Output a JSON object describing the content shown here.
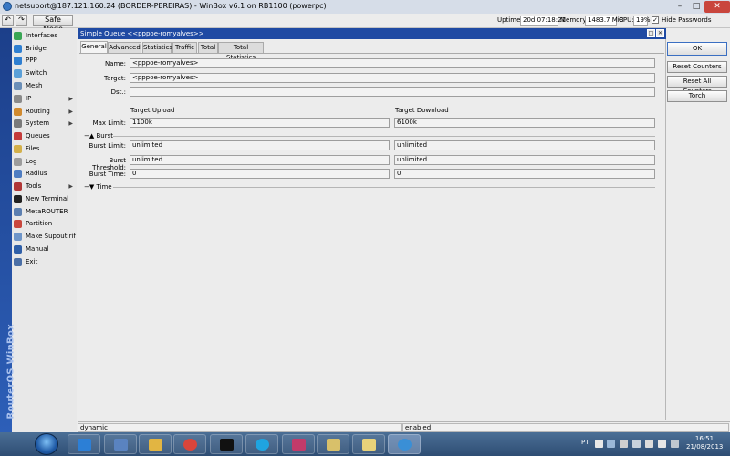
{
  "window": {
    "title": "netsuport@187.121.160.24 (BORDER-PEREIRAS) - WinBox v6.1 on RB1100 (powerpc)",
    "minimize": "–",
    "maximize": "□",
    "close": "✕"
  },
  "toolbar": {
    "undo": "↶",
    "redo": "↷",
    "safe_mode": "Safe Mode",
    "uptime_label": "Uptime:",
    "uptime_value": "20d 07:18:21",
    "memory_label": "Memory:",
    "memory_value": "1483.7 MiB",
    "cpu_label": "CPU:",
    "cpu_value": "19%",
    "hide_passwords_label": "Hide Passwords",
    "hide_passwords_checked": "✓"
  },
  "sidebar": {
    "brand": "RouterOS WinBox",
    "items": [
      {
        "label": "Interfaces",
        "icon": "interfaces-icon",
        "color": "#3aa655",
        "submenu": false
      },
      {
        "label": "Bridge",
        "icon": "bridge-icon",
        "color": "#2f7fd1",
        "submenu": false
      },
      {
        "label": "PPP",
        "icon": "ppp-icon",
        "color": "#2f7fd1",
        "submenu": false
      },
      {
        "label": "Switch",
        "icon": "switch-icon",
        "color": "#5ba0d8",
        "submenu": false
      },
      {
        "label": "Mesh",
        "icon": "mesh-icon",
        "color": "#6b8fb8",
        "submenu": false
      },
      {
        "label": "IP",
        "icon": "ip-icon",
        "color": "#8a8a8a",
        "submenu": true
      },
      {
        "label": "Routing",
        "icon": "routing-icon",
        "color": "#d18a2f",
        "submenu": true
      },
      {
        "label": "System",
        "icon": "system-icon",
        "color": "#7a7a7a",
        "submenu": true
      },
      {
        "label": "Queues",
        "icon": "queues-icon",
        "color": "#c43b3b",
        "submenu": false
      },
      {
        "label": "Files",
        "icon": "files-icon",
        "color": "#d3b04a",
        "submenu": false
      },
      {
        "label": "Log",
        "icon": "log-icon",
        "color": "#9c9c9c",
        "submenu": false
      },
      {
        "label": "Radius",
        "icon": "radius-icon",
        "color": "#4f7dc2",
        "submenu": false
      },
      {
        "label": "Tools",
        "icon": "tools-icon",
        "color": "#b03636",
        "submenu": true
      },
      {
        "label": "New Terminal",
        "icon": "terminal-icon",
        "color": "#222222",
        "submenu": false
      },
      {
        "label": "MetaROUTER",
        "icon": "metarouter-icon",
        "color": "#5c7fb0",
        "submenu": false
      },
      {
        "label": "Partition",
        "icon": "partition-icon",
        "color": "#c9473d",
        "submenu": false
      },
      {
        "label": "Make Supout.rif",
        "icon": "supout-icon",
        "color": "#6e95c9",
        "submenu": false
      },
      {
        "label": "Manual",
        "icon": "manual-icon",
        "color": "#2f5fa8",
        "submenu": false
      },
      {
        "label": "Exit",
        "icon": "exit-icon",
        "color": "#4b6fa6",
        "submenu": false
      }
    ]
  },
  "dialog": {
    "title": "Simple Queue <<pppoe-romyalves>>",
    "tabs": [
      "General",
      "Advanced",
      "Statistics",
      "Traffic",
      "Total",
      "Total Statistics"
    ],
    "active_tab": "General",
    "name_label": "Name:",
    "name_value": "<pppoe-romyalves>",
    "target_label": "Target:",
    "target_value": "<pppoe-romyalves>",
    "dst_label": "Dst.:",
    "dst_value": "",
    "col_upload": "Target Upload",
    "col_download": "Target Download",
    "max_limit_label": "Max Limit:",
    "max_limit_upload": "1100k",
    "max_limit_download": "6100k",
    "burst_section": "Burst",
    "burst_limit_label": "Burst Limit:",
    "burst_limit_upload": "unlimited",
    "burst_limit_download": "unlimited",
    "burst_threshold_label": "Burst Threshold:",
    "burst_threshold_upload": "unlimited",
    "burst_threshold_download": "unlimited",
    "burst_time_label": "Burst Time:",
    "burst_time_upload": "0",
    "burst_time_download": "0",
    "time_section": "Time",
    "buttons": {
      "ok": "OK",
      "reset_counters": "Reset Counters",
      "reset_all_counters": "Reset All Counters",
      "torch": "Torch"
    },
    "status_left": "dynamic",
    "status_right": "enabled"
  },
  "taskbar": {
    "items": [
      {
        "name": "ie-taskbar-icon",
        "color": "#2c7fd6"
      },
      {
        "name": "network-taskbar-icon",
        "color": "#5a83c0"
      },
      {
        "name": "explorer-taskbar-icon",
        "color": "#e2b542"
      },
      {
        "name": "chrome-taskbar-icon",
        "color": "#d9453b"
      },
      {
        "name": "cmd-taskbar-icon",
        "color": "#111111"
      },
      {
        "name": "skype-taskbar-icon",
        "color": "#1fa4e0"
      },
      {
        "name": "app-taskbar-icon",
        "color": "#c23b6a"
      },
      {
        "name": "folder-taskbar-icon",
        "color": "#d8c06a"
      },
      {
        "name": "notes-taskbar-icon",
        "color": "#e8d27a"
      },
      {
        "name": "winbox-taskbar-icon",
        "color": "#3a8fd6"
      }
    ],
    "language": "PT",
    "time": "16:51",
    "date": "21/08/2013"
  }
}
